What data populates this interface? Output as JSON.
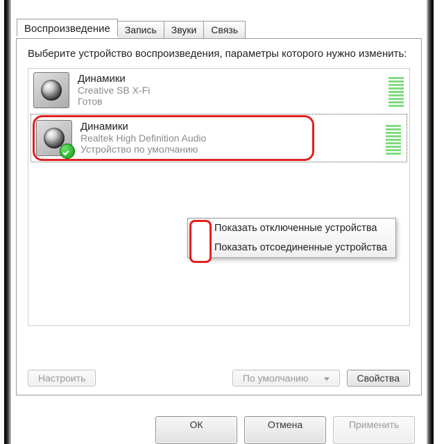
{
  "tabs": {
    "playback": "Воспроизведение",
    "recording": "Запись",
    "sounds": "Звуки",
    "comm": "Связь"
  },
  "instruction": "Выберите устройство воспроизведения, параметры которого нужно изменить:",
  "devices": [
    {
      "title": "Динамики",
      "sub1": "Creative SB X-Fi",
      "sub2": "Готов"
    },
    {
      "title": "Динамики",
      "sub1": "Realtek High Definition Audio",
      "sub2": "Устройство по умолчанию"
    }
  ],
  "context_menu": {
    "show_disabled": "Показать отключенные устройства",
    "show_disconnected": "Показать отсоединенные устройства"
  },
  "list_buttons": {
    "configure": "Настроить",
    "set_default": "По умолчанию",
    "properties": "Свойства"
  },
  "dialog_buttons": {
    "ok": "ОК",
    "cancel": "Отмена",
    "apply": "Применить"
  }
}
